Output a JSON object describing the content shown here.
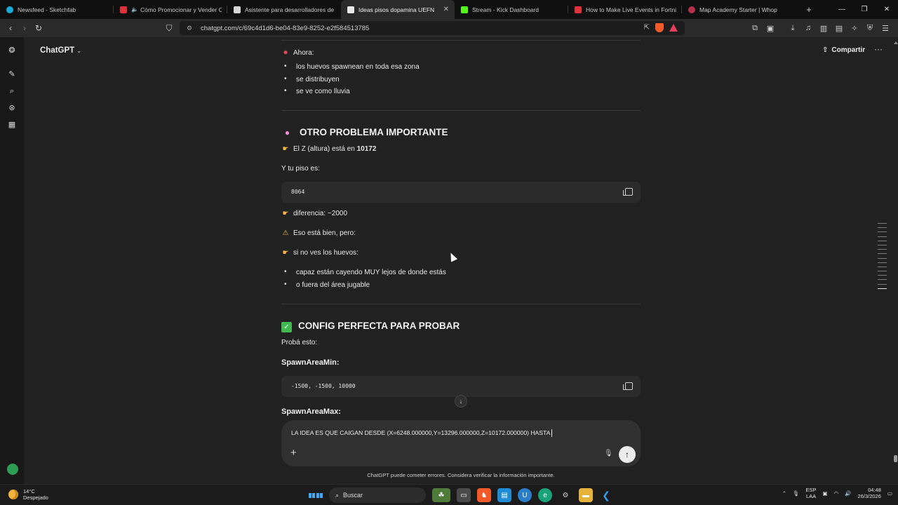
{
  "browser": {
    "tabs": [
      {
        "title": "Newsfeed - Sketchfab",
        "favicon_color": "#1caad9"
      },
      {
        "title": "Cómo Promocionar y Vender Cu",
        "favicon_color": "#e0313b"
      },
      {
        "title": "Asistente para desarrolladores de Ep",
        "favicon_color": "#d8d8d8"
      },
      {
        "title": "Ideas pisos dopamina UEFN",
        "favicon_color": "#e8e8e8",
        "active": true
      },
      {
        "title": "Stream - Kick Dashboard",
        "favicon_color": "#53fc18"
      },
      {
        "title": "How to Make Live Events in Fortnite",
        "favicon_color": "#e0313b"
      },
      {
        "title": "Map Academy Starter | Whop",
        "favicon_color": "#b5304a"
      }
    ],
    "close_glyph": "✕",
    "new_tab_glyph": "+",
    "window_controls": [
      "—",
      "❐",
      "✕"
    ],
    "url": "chatgpt.com/c/69c4d1d6-be04-83e9-8252-e2f584513785"
  },
  "header": {
    "brand": "ChatGPT",
    "share_label": "Compartir",
    "more_glyph": "···"
  },
  "conversation": {
    "ahora_label": "Ahora:",
    "ahora_bullets": [
      "los huevos spawnean en toda esa zona",
      "se distribuyen",
      "se ve como lluvia"
    ],
    "section1_title": "OTRO PROBLEMA IMPORTANTE",
    "z_line_prefix": "El Z (altura) está en ",
    "z_value": "10172",
    "floor_label": "Y tu piso es:",
    "floor_code": "8064",
    "difference_line": "diferencia: ~2000",
    "warning_line": "Eso está bien, pero:",
    "if_line": "si no ves los huevos:",
    "if_bullets": [
      "capaz están cayendo MUY lejos de donde estás",
      "o fuera del área jugable"
    ],
    "section2_title": "CONFIG PERFECTA PARA PROBAR",
    "try_label": "Probá esto:",
    "min_label": "SpawnAreaMin:",
    "min_code": "-1500, -1500, 10000",
    "max_label": "SpawnAreaMax:"
  },
  "composer": {
    "draft_text": "LA IDEA ES QUE CAIGAN DESDE (X=6248.000000,Y=13296.000000,Z=10172.000000) HASTA",
    "disclaimer": "ChatGPT puede cometer errores. Considera verificar la información importante."
  },
  "taskbar": {
    "temperature": "14°C",
    "weather": "Despejado",
    "search_label": "Buscar",
    "lang_top": "ESP",
    "lang_bottom": "LAA",
    "time": "04:48",
    "date": "26/3/2026"
  },
  "icons": {
    "rail": [
      "openai-logo-icon",
      "new-chat-icon",
      "search-icon",
      "gpts-icon",
      "library-icon"
    ],
    "accent_green": "#2d9d54"
  }
}
